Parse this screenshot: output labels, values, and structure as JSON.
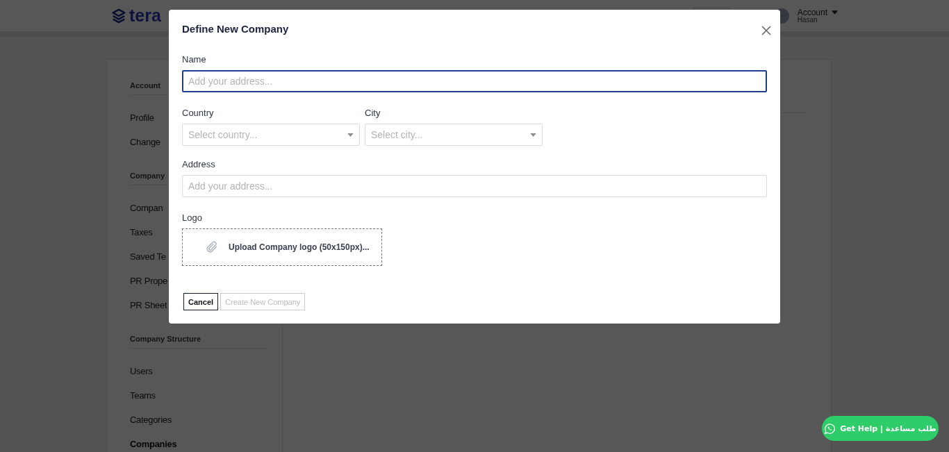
{
  "header": {
    "logo_text": "tera",
    "account": {
      "label": "Account",
      "user": "Hasan"
    }
  },
  "sidebar": {
    "sections": [
      {
        "title": "Account",
        "items": [
          {
            "label": "Profile",
            "selected": false
          },
          {
            "label": "Change",
            "selected": false
          }
        ]
      },
      {
        "title": "Company",
        "items": [
          {
            "label": "Compan",
            "selected": false
          },
          {
            "label": "Taxes",
            "selected": false
          },
          {
            "label": "Saved Te",
            "selected": false
          },
          {
            "label": "PR Prope",
            "selected": false
          },
          {
            "label": "PR Sheet",
            "selected": false
          }
        ]
      },
      {
        "title": "Company Structure",
        "items": [
          {
            "label": "Users",
            "selected": false
          },
          {
            "label": "Teams",
            "selected": false
          },
          {
            "label": "Categories",
            "selected": false
          },
          {
            "label": "Companies",
            "selected": true
          }
        ]
      }
    ]
  },
  "modal": {
    "title": "Define New Company",
    "name": {
      "label": "Name",
      "placeholder": "Add your address...",
      "focused": true
    },
    "country": {
      "label": "Country",
      "placeholder": "Select country..."
    },
    "city": {
      "label": "City",
      "placeholder": "Select city..."
    },
    "address": {
      "label": "Address",
      "placeholder": "Add your address...",
      "focused": false
    },
    "logo": {
      "label": "Logo",
      "upload_text": "Upload Company logo (50x150px)..."
    },
    "buttons": [
      {
        "label": "Cancel",
        "disabled": false
      },
      {
        "label": "Create New Company",
        "disabled": true
      }
    ]
  },
  "help_button": {
    "label": "Get Help | طلب مساعدة"
  }
}
